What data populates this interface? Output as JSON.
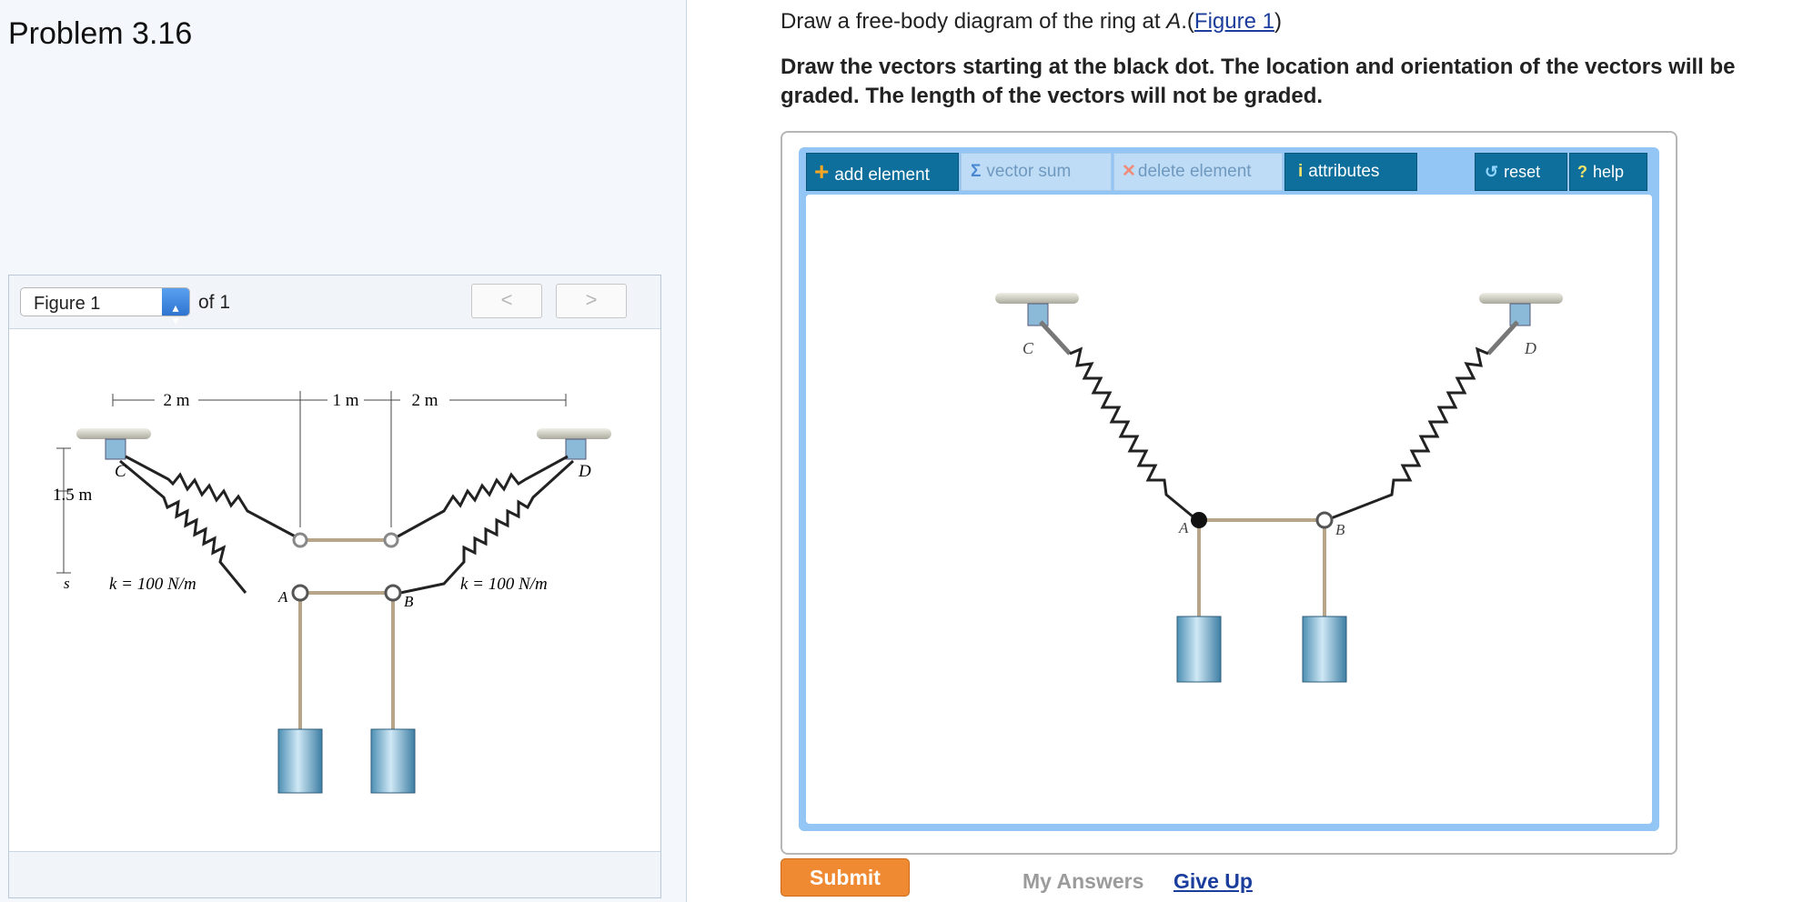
{
  "problem": {
    "title": "Problem 3.16"
  },
  "figure_panel": {
    "select_label": "Figure 1",
    "of_label": "of 1",
    "prev_label": "<",
    "next_label": ">"
  },
  "figure": {
    "dim_2m_left": "2 m",
    "dim_1m": "1 m",
    "dim_2m_right": "2 m",
    "dim_height": "1.5 m",
    "dim_s": "s",
    "k_left": "k = 100 N/m",
    "k_right": "k = 100 N/m",
    "label_c": "C",
    "label_d": "D",
    "label_a": "A",
    "label_b": "B"
  },
  "question": {
    "prefix": "Draw a free-body diagram of the ring at ",
    "point": "A",
    "dot_paren": ".(",
    "figure_link": "Figure 1",
    "close_paren": ")",
    "bold_text": "Draw the vectors starting at the black dot. The location and orientation of the vectors will be graded. The length of the vectors will not be graded."
  },
  "toolbar": {
    "add_element": "add element",
    "vector_sum": "vector sum",
    "delete_element": "delete element",
    "attributes": "attributes",
    "reset": "reset",
    "help": "help"
  },
  "canvas_labels": {
    "c": "C",
    "d": "D",
    "a": "A",
    "b": "B"
  },
  "actions": {
    "submit": "Submit",
    "my_answers": "My Answers",
    "give_up": "Give Up"
  },
  "colors": {
    "toolbar_active": "#0e6f9c",
    "applet_border": "#93c6f4",
    "submit": "#ef8a32",
    "link": "#1b3d9c"
  }
}
